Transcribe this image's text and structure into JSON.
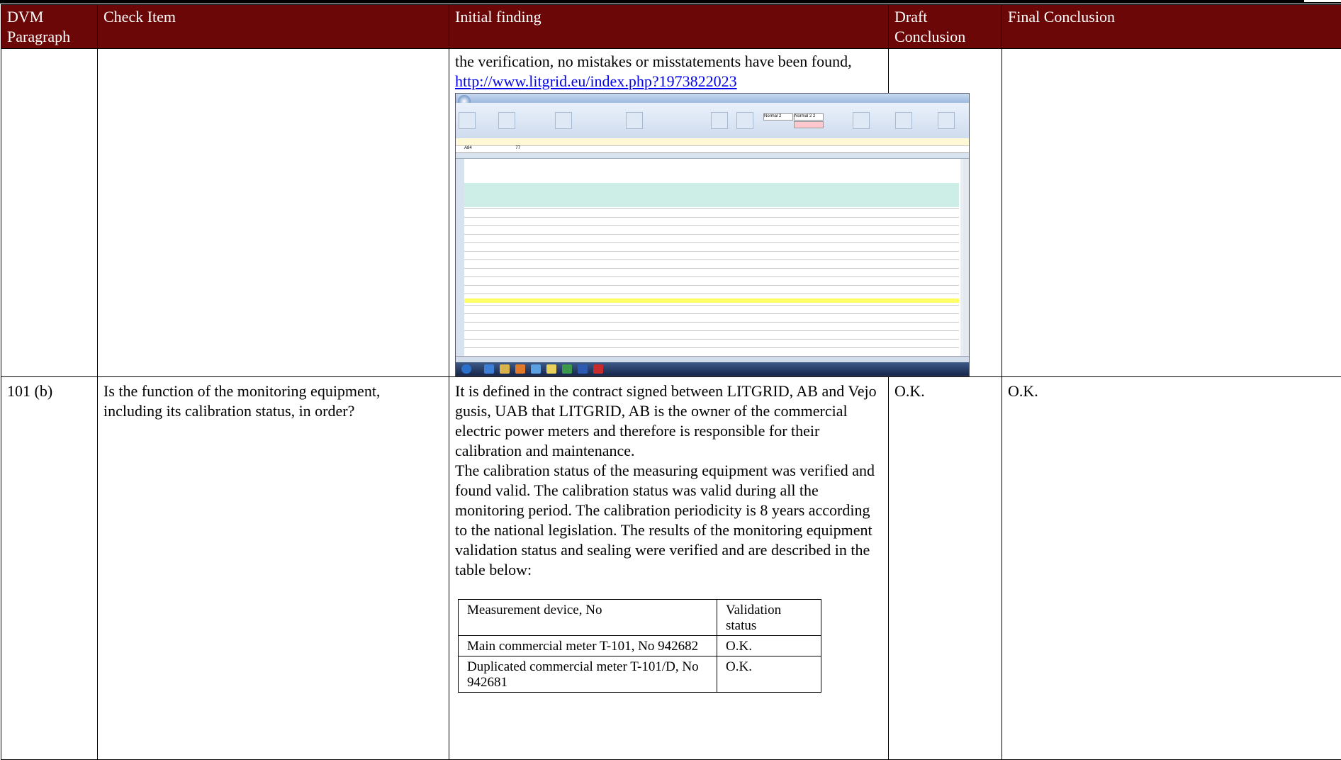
{
  "header": {
    "col1": "DVM Paragraph",
    "col2": "Check Item",
    "col3": "Initial finding",
    "col4": "Draft Conclusion",
    "col5": "Final Conclusion"
  },
  "row1": {
    "text": "the verification, no mistakes or misstatements have been found,",
    "url": "http://www.litgrid.eu/index.php?1973822023"
  },
  "row2": {
    "paragraph": "101 (b)",
    "check_item": "Is the function of the monitoring equipment, including its calibration status, in order?",
    "finding_p1": "It is defined in the contract signed between LITGRID, AB and Vejo gusis, UAB that LITGRID, AB is the owner of the commercial electric power meters and therefore is responsible for their calibration and maintenance.",
    "finding_p2": "The calibration status of the measuring equipment was verified and found valid. The calibration status was valid during all the monitoring period.  The calibration periodicity is 8 years according to the national legislation. The results of the monitoring equipment validation status and sealing were verified and are described in the table below:",
    "draft": "O.K.",
    "final": "O.K."
  },
  "device_table": {
    "headers": [
      "Measurement device, No",
      "Validation status"
    ],
    "rows": [
      {
        "device": "Main commercial meter T-101, No 942682",
        "status": "O.K."
      },
      {
        "device": "Duplicated commercial meter T-101/D, No 942681",
        "status": "O.K."
      }
    ]
  },
  "screenshot": {
    "style_normal2": "Normal 2",
    "style_normal22": "Normal 2 2",
    "style_paprastas": "Paprastas",
    "cell_ref": "A84",
    "formula_value": "77"
  }
}
